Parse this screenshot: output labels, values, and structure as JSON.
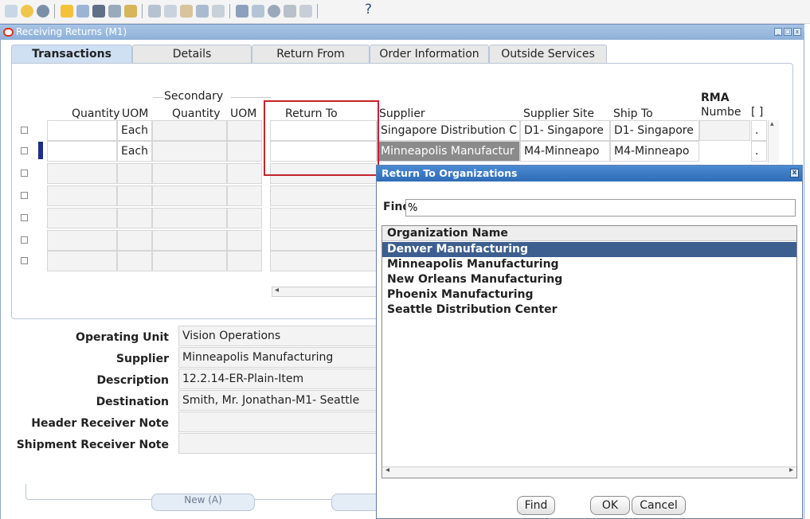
{
  "toolbar": {
    "help_glyph": "?"
  },
  "window": {
    "title": "Receiving Returns (M1)"
  },
  "tabs": [
    {
      "label": "Transactions"
    },
    {
      "label": "Details"
    },
    {
      "label": "Return From"
    },
    {
      "label": "Order Information"
    },
    {
      "label": "Outside Services"
    }
  ],
  "grid": {
    "group_header": "Secondary",
    "headers": {
      "quantity": "Quantity",
      "uom": "UOM",
      "secondary_quantity": "Quantity",
      "secondary_uom": "UOM",
      "return_to": "Return To",
      "supplier": "Supplier",
      "supplier_site": "Supplier Site",
      "ship_to": "Ship To",
      "rma_line1": "RMA",
      "rma_line2": "Numbe",
      "bracket": "[ ]"
    },
    "rows": [
      {
        "uom": "Each",
        "supplier": "Singapore Distribution C",
        "supplier_site": "D1- Singapore",
        "ship_to": "D1- Singapore",
        "more": "."
      },
      {
        "uom": "Each",
        "supplier": "Minneapolis Manufactur",
        "supplier_site": "M4-Minneapo",
        "ship_to": "M4-Minneapo",
        "more": "."
      }
    ]
  },
  "fields": {
    "operating_unit": {
      "label": "Operating Unit",
      "value": "Vision Operations"
    },
    "supplier": {
      "label": "Supplier",
      "value": "Minneapolis Manufacturing"
    },
    "description": {
      "label": "Description",
      "value": "12.2.14-ER-Plain-Item"
    },
    "destination": {
      "label": "Destination",
      "value": "Smith, Mr. Jonathan-M1- Seattle"
    },
    "header_note": {
      "label": "Header Receiver Note",
      "value": ""
    },
    "shipment_note": {
      "label": "Shipment Receiver Note",
      "value": ""
    }
  },
  "buttons": {
    "new_label": "New (A)"
  },
  "lov": {
    "title": "Return To Organizations",
    "find_label": "Find",
    "find_value": "%",
    "column_header": "Organization Name",
    "items": [
      "Denver Manufacturing",
      "Minneapolis Manufacturing",
      "New Orleans Manufacturing",
      "Phoenix Manufacturing",
      "Seattle Distribution Center"
    ],
    "find_button": "Find",
    "ok_button": "OK",
    "cancel_button": "Cancel"
  }
}
